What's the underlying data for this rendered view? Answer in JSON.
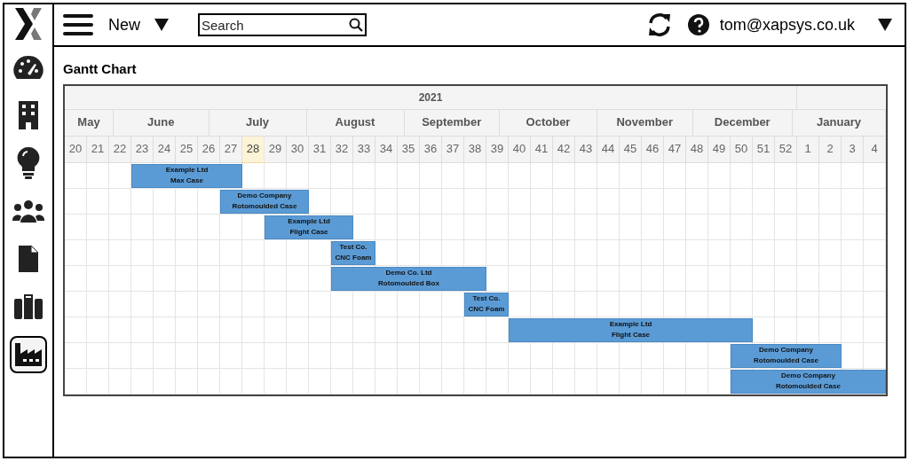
{
  "topbar": {
    "new_label": "New",
    "search": {
      "placeholder": "Search"
    },
    "user": "tom@xapsys.co.uk"
  },
  "sidebar": {
    "items": [
      {
        "kind": "dashboard",
        "selected": false
      },
      {
        "kind": "building",
        "selected": false
      },
      {
        "kind": "idea",
        "selected": false
      },
      {
        "kind": "people",
        "selected": false
      },
      {
        "kind": "document",
        "selected": false
      },
      {
        "kind": "case",
        "selected": false
      },
      {
        "kind": "factory",
        "selected": true
      }
    ]
  },
  "page_title": "Gantt Chart",
  "gantt": {
    "year": "2021",
    "months": [
      "May",
      "June",
      "July",
      "August",
      "September",
      "October",
      "November",
      "December",
      "January"
    ],
    "weeks": [
      {
        "label": "20",
        "current": false
      },
      {
        "label": "21",
        "current": false
      },
      {
        "label": "22",
        "current": false
      },
      {
        "label": "23",
        "current": false
      },
      {
        "label": "24",
        "current": false
      },
      {
        "label": "25",
        "current": false
      },
      {
        "label": "26",
        "current": false
      },
      {
        "label": "27",
        "current": false
      },
      {
        "label": "28",
        "current": true
      },
      {
        "label": "29",
        "current": false
      },
      {
        "label": "30",
        "current": false
      },
      {
        "label": "31",
        "current": false
      },
      {
        "label": "32",
        "current": false
      },
      {
        "label": "33",
        "current": false
      },
      {
        "label": "34",
        "current": false
      },
      {
        "label": "35",
        "current": false
      },
      {
        "label": "36",
        "current": false
      },
      {
        "label": "37",
        "current": false
      },
      {
        "label": "38",
        "current": false
      },
      {
        "label": "39",
        "current": false
      },
      {
        "label": "40",
        "current": false
      },
      {
        "label": "41",
        "current": false
      },
      {
        "label": "42",
        "current": false
      },
      {
        "label": "43",
        "current": false
      },
      {
        "label": "44",
        "current": false
      },
      {
        "label": "45",
        "current": false
      },
      {
        "label": "46",
        "current": false
      },
      {
        "label": "47",
        "current": false
      },
      {
        "label": "48",
        "current": false
      },
      {
        "label": "49",
        "current": false
      },
      {
        "label": "50",
        "current": false
      },
      {
        "label": "51",
        "current": false
      },
      {
        "label": "52",
        "current": false
      },
      {
        "label": "1",
        "current": false
      },
      {
        "label": "2",
        "current": false
      },
      {
        "label": "3",
        "current": false
      },
      {
        "label": "4",
        "current": false
      }
    ],
    "tasks": [
      {
        "customer": "Example Ltd",
        "product": "Max Case"
      },
      {
        "customer": "Demo Company",
        "product": "Rotomoulded Case"
      },
      {
        "customer": "Example Ltd",
        "product": "Flight Case"
      },
      {
        "customer": "Test Co.",
        "product": "CNC Foam"
      },
      {
        "customer": "Demo Co. Ltd",
        "product": "Rotomoulded Box"
      },
      {
        "customer": "Test Co.",
        "product": "CNC Foam"
      },
      {
        "customer": "Example Ltd",
        "product": "Flight Case"
      },
      {
        "customer": "Demo Company",
        "product": "Rotomoulded Case"
      },
      {
        "customer": "Demo Company",
        "product": "Rotomoulded Case"
      }
    ]
  }
}
